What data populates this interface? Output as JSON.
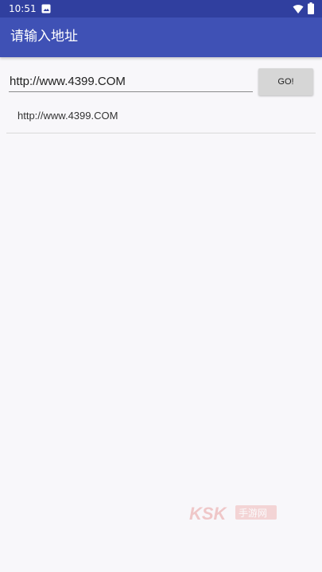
{
  "status_bar": {
    "time": "10:51",
    "notification_icon": "image-icon",
    "wifi_icon": "wifi-icon",
    "battery_icon": "battery-icon",
    "color": "#303f9f"
  },
  "toolbar": {
    "title": "请输入地址",
    "color": "#3f51b5"
  },
  "address_bar": {
    "value": "http://www.4399.COM",
    "go_label": "GO!"
  },
  "history": [
    {
      "label": "http://www.4399.COM"
    }
  ],
  "watermark": {
    "text": "KSK",
    "subtext": "手游网"
  }
}
